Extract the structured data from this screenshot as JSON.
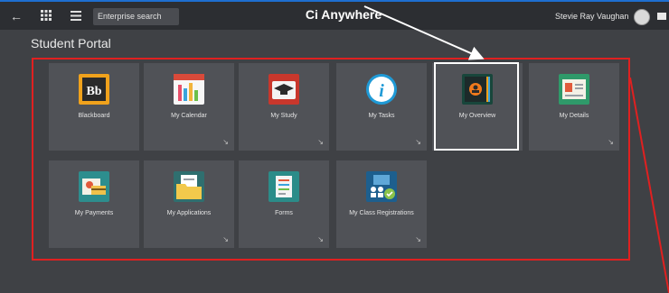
{
  "topbar": {
    "search_placeholder": "Enterprise search",
    "app_title": "Ci Anywhere",
    "user_name": "Stevie Ray Vaughan"
  },
  "portal": {
    "title": "Student Portal",
    "tiles": [
      {
        "label": "Blackboard",
        "icon": "blackboard-icon",
        "color": "#f0a21c"
      },
      {
        "label": "My Calendar",
        "icon": "calendar-icon",
        "color": "#f7f7f7"
      },
      {
        "label": "My Study",
        "icon": "graduation-cap-icon",
        "color": "#c9372c"
      },
      {
        "label": "My Tasks",
        "icon": "info-icon",
        "color": "#1f9ad6"
      },
      {
        "label": "My Overview",
        "icon": "overview-book-icon",
        "color": "#18463b"
      },
      {
        "label": "My Details",
        "icon": "details-card-icon",
        "color": "#2f9a6a"
      },
      {
        "label": "My Payments",
        "icon": "payments-icon",
        "color": "#2d8e8e"
      },
      {
        "label": "My Applications",
        "icon": "folder-icon",
        "color": "#f2c94c"
      },
      {
        "label": "Forms",
        "icon": "forms-icon",
        "color": "#2b8c89"
      },
      {
        "label": "My Class Registrations",
        "icon": "class-registration-icon",
        "color": "#1d5f8e"
      }
    ]
  },
  "annotations": {
    "highlight_color": "#e02020",
    "focus_color": "#ffffff"
  }
}
